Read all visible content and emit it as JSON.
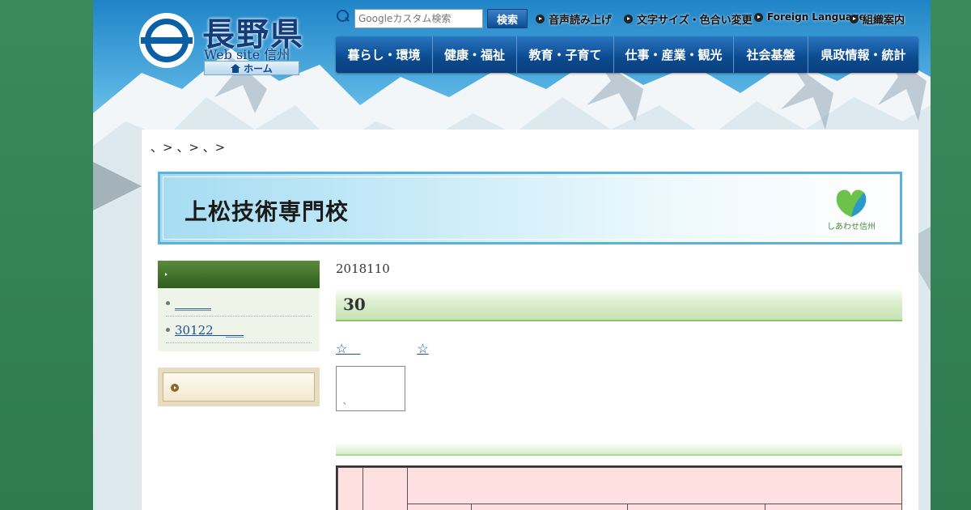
{
  "header": {
    "prefecture_name": "長野県",
    "site_label": "Web site 信州",
    "home_label": "ホーム",
    "search_placeholder": "Googleカスタム検索",
    "search_button": "検索",
    "util_links": [
      "音声読み上げ",
      "文字サイズ・色合い変更",
      "Foreign Language",
      "組織案内"
    ]
  },
  "gnav": {
    "items": [
      "暮らし・環境",
      "健康・福祉",
      "教育・子育て",
      "仕事・産業・観光",
      "社会基盤",
      "県政情報・統計"
    ]
  },
  "breadcrumb": "、> 、> 、>",
  "banner": {
    "title": "上松技術専門校",
    "logo_text": "しあわせ信州"
  },
  "sidebar": {
    "items": [
      "______",
      "30122　___"
    ]
  },
  "main": {
    "date": "2018110",
    "heading": "30",
    "links": [
      "☆　",
      "☆"
    ],
    "image_caption": "、"
  },
  "colors": {
    "nav_blue": "#0b4a8f",
    "side_green": "#2f5d1e",
    "banner_border": "#5ab1d9",
    "table_pink": "#ffe0e0"
  }
}
